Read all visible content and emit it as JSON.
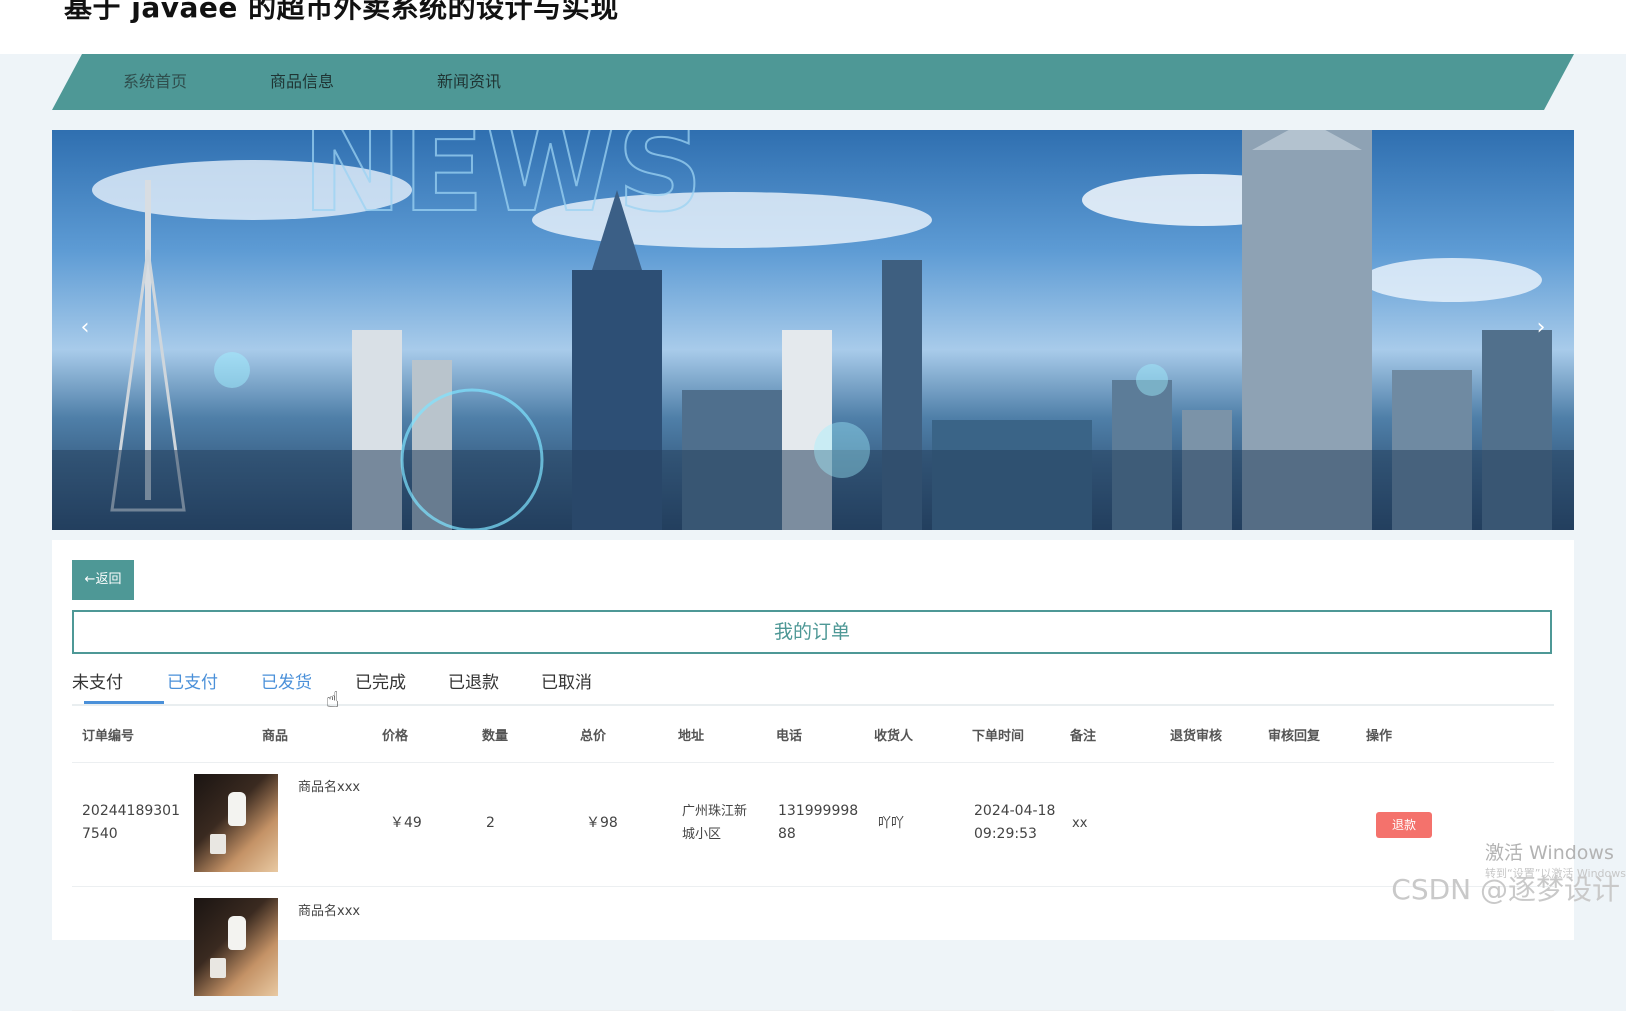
{
  "site": {
    "title": "基于 javaee 的超市外卖系统的设计与实现"
  },
  "nav": {
    "items": [
      "系统首页",
      "商品信息",
      "新闻资讯"
    ]
  },
  "carousel": {
    "prev": "‹",
    "next": "›"
  },
  "panel": {
    "back_label": "←返回",
    "heading": "我的订单",
    "tabs": [
      "未支付",
      "已支付",
      "已发货",
      "已完成",
      "已退款",
      "已取消"
    ]
  },
  "table": {
    "headers": [
      "订单编号",
      "商品",
      "价格",
      "数量",
      "总价",
      "地址",
      "电话",
      "收货人",
      "下单时间",
      "备注",
      "退货审核",
      "审核回复",
      "操作"
    ],
    "rows": [
      {
        "order_id_l1": "20244189301",
        "order_id_l2": "7540",
        "product": "商品名xxx",
        "price": "￥49",
        "qty": "2",
        "total": "￥98",
        "addr_l1": "广州珠江新",
        "addr_l2": "城小区",
        "phone_l1": "131999998",
        "phone_l2": "88",
        "receiver": "吖吖",
        "time_l1": "2024-04-18",
        "time_l2": "09:29:53",
        "remark": "xx",
        "action": "退款"
      },
      {
        "product": "商品名xxx"
      }
    ]
  },
  "watermarks": {
    "windows": "激活 Windows",
    "windows_sub": "转到“设置”以激活 Windows",
    "csdn": "CSDN @逐梦设计"
  },
  "colors": {
    "accent": "#4e9896",
    "tab_active": "#4a90d9",
    "refund": "#f4726c"
  },
  "icons": {
    "back": "arrow-left-icon",
    "cursor": "hand-cursor-icon"
  }
}
